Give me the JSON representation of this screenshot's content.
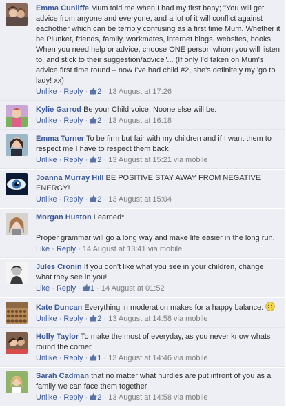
{
  "comments": [
    {
      "author": "Emma Cunliffe",
      "text": "Mum told me when I had my first baby; \"You will get advice from anyone and everyone, and a lot of it will conflict against eachother which can be terribly confusing as a first time Mum. Whether it be Plunket, friends, family, workmates, internet blogs, websites, books... When you need help or advice, choose ONE person whom you will listen to, and stick to their suggestion/advice\"... (If only I'd taken on Mum's advice first time round – now I've had child #2, she's definitely my 'go to' lady! xx)",
      "like_action": "Unlike",
      "reply": "Reply",
      "likes": "2",
      "time": "13 August at 17:26",
      "via": ""
    },
    {
      "author": "Kylie Garrod",
      "text": "Be your Child voice. Noone else will be.",
      "like_action": "Unlike",
      "reply": "Reply",
      "likes": "2",
      "time": "13 August at 16:18",
      "via": ""
    },
    {
      "author": "Emma Turner",
      "text": "To be firm but fair with my children and if I want them to respect me I have to respect them back",
      "like_action": "Unlike",
      "reply": "Reply",
      "likes": "2",
      "time": "13 August at 15:21",
      "via": "via mobile"
    },
    {
      "author": "Joanna Murray Hill",
      "text": "BE POSITIVE STAY AWAY FROM NEGATIVE ENERGY!",
      "like_action": "Unlike",
      "reply": "Reply",
      "likes": "2",
      "time": "13 August at 15:04",
      "via": ""
    },
    {
      "author": "Morgan Huston",
      "text": "Learned*",
      "text2": "Proper grammar will go a long way and make life easier in the long run.",
      "like_action": "Like",
      "reply": "Reply",
      "likes": "",
      "time": "14 August at 13:41",
      "via": "via mobile"
    },
    {
      "author": "Jules Cronin",
      "text": "If you don't like what you see in your children, change what they see in you!",
      "like_action": "Like",
      "reply": "Reply",
      "likes": "1",
      "time": "14 August at 01:52",
      "via": ""
    },
    {
      "author": "Kate Duncan",
      "text": "Everything in moderation makes for a happy balance.",
      "emoji": "smiley-emoji",
      "like_action": "Unlike",
      "reply": "Reply",
      "likes": "2",
      "time": "13 August at 14:58",
      "via": "via mobile"
    },
    {
      "author": "Holly Taylor",
      "text": "To make the most of everyday, as you never know whats round the corner",
      "like_action": "Unlike",
      "reply": "Reply",
      "likes": "1",
      "time": "13 August at 14:46",
      "via": "via mobile"
    },
    {
      "author": "Sarah Cadman",
      "text": "that no matter what hurdles are put infront of you as a family we can face them together",
      "like_action": "Unlike",
      "reply": "Reply",
      "likes": "2",
      "time": "13 August at 14:58",
      "via": "via mobile"
    }
  ],
  "icons": {
    "like": "thumbs-up-icon",
    "emoji": "smiley-emoji"
  },
  "colors": {
    "author": "#3b5998",
    "background": "#edeff4",
    "timestamp": "#808080"
  }
}
